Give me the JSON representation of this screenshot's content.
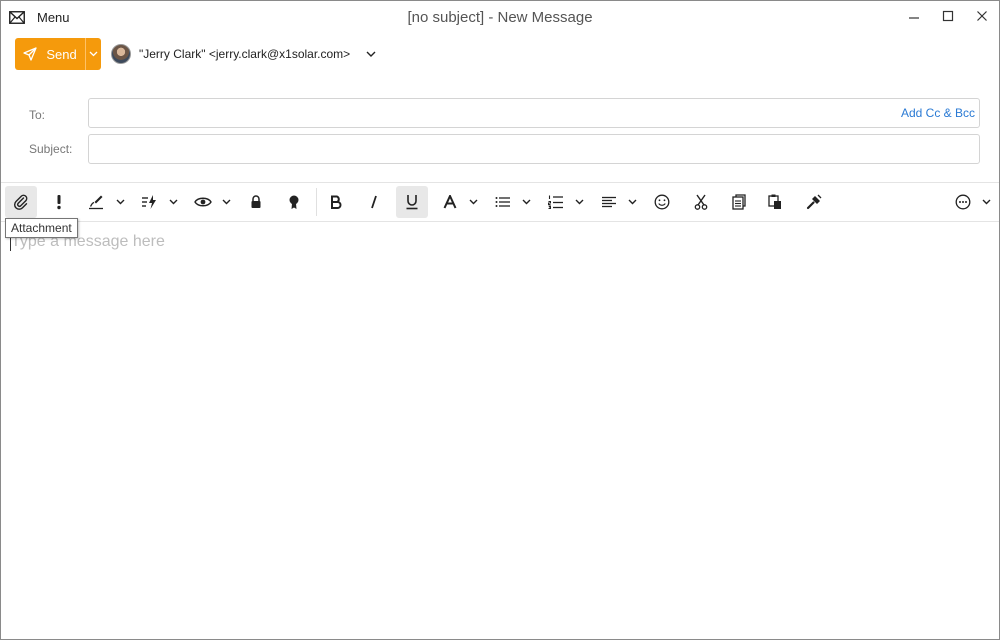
{
  "titlebar": {
    "menu_label": "Menu",
    "window_title": "[no subject] - New Message"
  },
  "send": {
    "label": "Send",
    "color": "#f59a0c"
  },
  "from": {
    "display": "\"Jerry Clark\" <jerry.clark@x1solar.com>"
  },
  "fields": {
    "to_label": "To:",
    "to_value": "",
    "add_cc_bcc": "Add Cc & Bcc",
    "subject_label": "Subject:",
    "subject_value": ""
  },
  "toolbar": {
    "tooltip": "Attachment",
    "items": [
      "paperclip-icon",
      "exclamation-icon",
      "signature-icon",
      "quick-parts-icon",
      "eye-icon",
      "lock-icon",
      "seal-icon",
      "bold-icon",
      "italic-icon",
      "underline-icon",
      "font-color-icon",
      "bullet-list-icon",
      "numbered-list-icon",
      "align-icon",
      "emoji-icon",
      "cut-icon",
      "copy-icon",
      "paste-icon",
      "format-painter-icon",
      "more-icon"
    ]
  },
  "body": {
    "placeholder": "Type a message here"
  },
  "colors": {
    "accent": "#f59a0c",
    "link": "#2a7ad4"
  }
}
